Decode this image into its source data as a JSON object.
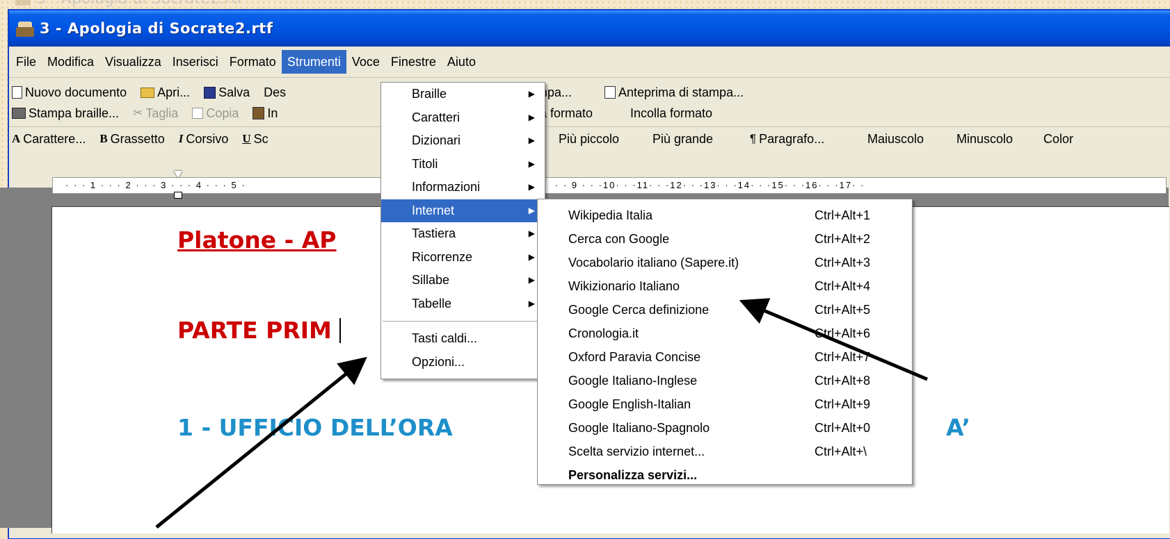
{
  "background": {
    "ghost_title": "3 - Apologia di Socrate2.rtf"
  },
  "window": {
    "title": "3 - Apologia di Socrate2.rtf",
    "colors": {
      "titlebar": "#0058e6",
      "menu_highlight": "#316ac5"
    }
  },
  "menubar": {
    "items": [
      "File",
      "Modifica",
      "Visualizza",
      "Inserisci",
      "Formato",
      "Strumenti",
      "Voce",
      "Finestre",
      "Aiuto"
    ],
    "active": "Strumenti"
  },
  "toolbar1": {
    "new_doc": "Nuovo documento",
    "open": "Apri...",
    "save": "Salva",
    "des": "Des",
    "print_fragment": "mpa...",
    "preview": "Anteprima di stampa..."
  },
  "toolbar2": {
    "print_braille": "Stampa braille...",
    "cut": "Taglia",
    "copy": "Copia",
    "paste_fragment": "In",
    "copy_format_fragment": "ia formato",
    "paste_format": "Incolla formato"
  },
  "toolbar3": {
    "character": "Carattere...",
    "bold": "Grassetto",
    "italic": "Corsivo",
    "underline_fragment": "Sc",
    "smaller": "Più piccolo",
    "bigger": "Più grande",
    "paragraph": "Paragrafo...",
    "uppercase": "Maiuscolo",
    "lowercase": "Minuscolo",
    "color_fragment": "Color"
  },
  "ruler": {
    "left": "· · · 1 · · · 2 · · · 3 · · · 4 · · · 5 ·",
    "right": "· · 9 · · ·10· · ·11· · ·12· · ·13· · ·14· · ·15· · ·16· · ·17· ·"
  },
  "document": {
    "heading": "Platone - AP",
    "subheading": "PARTE PRIM",
    "section": "1 - UFFICIO DELL’ORA",
    "section_tail": "A’"
  },
  "strumenti_menu": {
    "items": [
      {
        "label": "Braille",
        "submenu": true
      },
      {
        "label": "Caratteri",
        "submenu": true
      },
      {
        "label": "Dizionari",
        "submenu": true
      },
      {
        "label": "Titoli",
        "submenu": true
      },
      {
        "label": "Informazioni",
        "submenu": true
      },
      {
        "label": "Internet",
        "submenu": true
      },
      {
        "label": "Tastiera",
        "submenu": true
      },
      {
        "label": "Ricorrenze",
        "submenu": true
      },
      {
        "label": "Sillabe",
        "submenu": true
      },
      {
        "label": "Tabelle",
        "submenu": true
      }
    ],
    "extra": [
      "Tasti caldi...",
      "Opzioni..."
    ],
    "highlighted": "Internet"
  },
  "internet_menu": {
    "items": [
      {
        "label": "Wikipedia Italia",
        "shortcut": "Ctrl+Alt+1"
      },
      {
        "label": "Cerca con Google",
        "shortcut": "Ctrl+Alt+2"
      },
      {
        "label": "Vocabolario italiano (Sapere.it)",
        "shortcut": "Ctrl+Alt+3"
      },
      {
        "label": "Wikizionario Italiano",
        "shortcut": "Ctrl+Alt+4"
      },
      {
        "label": "Google Cerca definizione",
        "shortcut": "Ctrl+Alt+5"
      },
      {
        "label": "Cronologia.it",
        "shortcut": "Ctrl+Alt+6"
      },
      {
        "label": "Oxford Paravia Concise",
        "shortcut": "Ctrl+Alt+7"
      },
      {
        "label": "Google Italiano-Inglese",
        "shortcut": "Ctrl+Alt+8"
      },
      {
        "label": "Google English-Italian",
        "shortcut": "Ctrl+Alt+9"
      },
      {
        "label": "Google Italiano-Spagnolo",
        "shortcut": "Ctrl+Alt+0"
      },
      {
        "label": "Scelta servizio internet...",
        "shortcut": "Ctrl+Alt+\\"
      }
    ],
    "customize": "Personalizza servizi..."
  }
}
